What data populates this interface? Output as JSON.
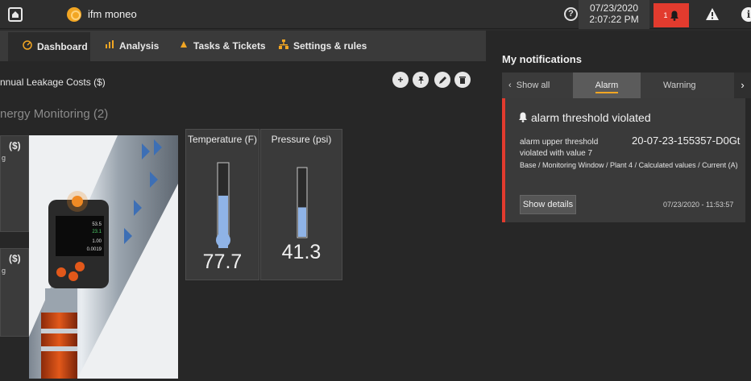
{
  "topbar": {
    "app_title": "ifm moneo",
    "date": "07/23/2020",
    "time": "2:07:22 PM",
    "alarm_count": "1",
    "help_symbol": "?",
    "info_symbol": "i"
  },
  "nav": {
    "tabs": [
      {
        "label": "Dashboard",
        "icon": "gauge-icon"
      },
      {
        "label": "Analysis",
        "icon": "analysis-icon"
      },
      {
        "label": "Tasks & Tickets",
        "icon": "tasks-icon"
      },
      {
        "label": "Settings & rules",
        "icon": "settings-rules-icon"
      }
    ]
  },
  "dashboard": {
    "widget_title": "nnual Leakage Costs ($)",
    "section_title": "nergy Monitoring (2)",
    "side_cards": [
      {
        "title": "($)",
        "sub": "g"
      },
      {
        "title": "($)",
        "sub": "g"
      }
    ],
    "device_readings": [
      "53.5",
      "23.1",
      "1.00",
      "0.0019"
    ],
    "gauges": [
      {
        "title": "Temperature (F)",
        "value": "77.7",
        "level": 0.62
      },
      {
        "title": "Pressure (psi)",
        "value": "41.3",
        "level": 0.43
      }
    ]
  },
  "notifications": {
    "title": "My notifications",
    "tabs": [
      "Show all",
      "Alarm",
      "Warning"
    ],
    "active_tab": "Alarm",
    "alarm": {
      "title": "alarm threshold violated",
      "message": "alarm upper threshold violated with value 7",
      "id": "20-07-23-155357-D0Gt",
      "path": "Base / Monitoring Window / Plant 4 / Calculated values / Current (A)",
      "button": "Show details",
      "timestamp": "07/23/2020 - 11:53:57"
    }
  },
  "colors": {
    "alarm_red": "#e23b2e",
    "accent_orange": "#f2a623",
    "gauge_blue": "#8fb3e6"
  }
}
